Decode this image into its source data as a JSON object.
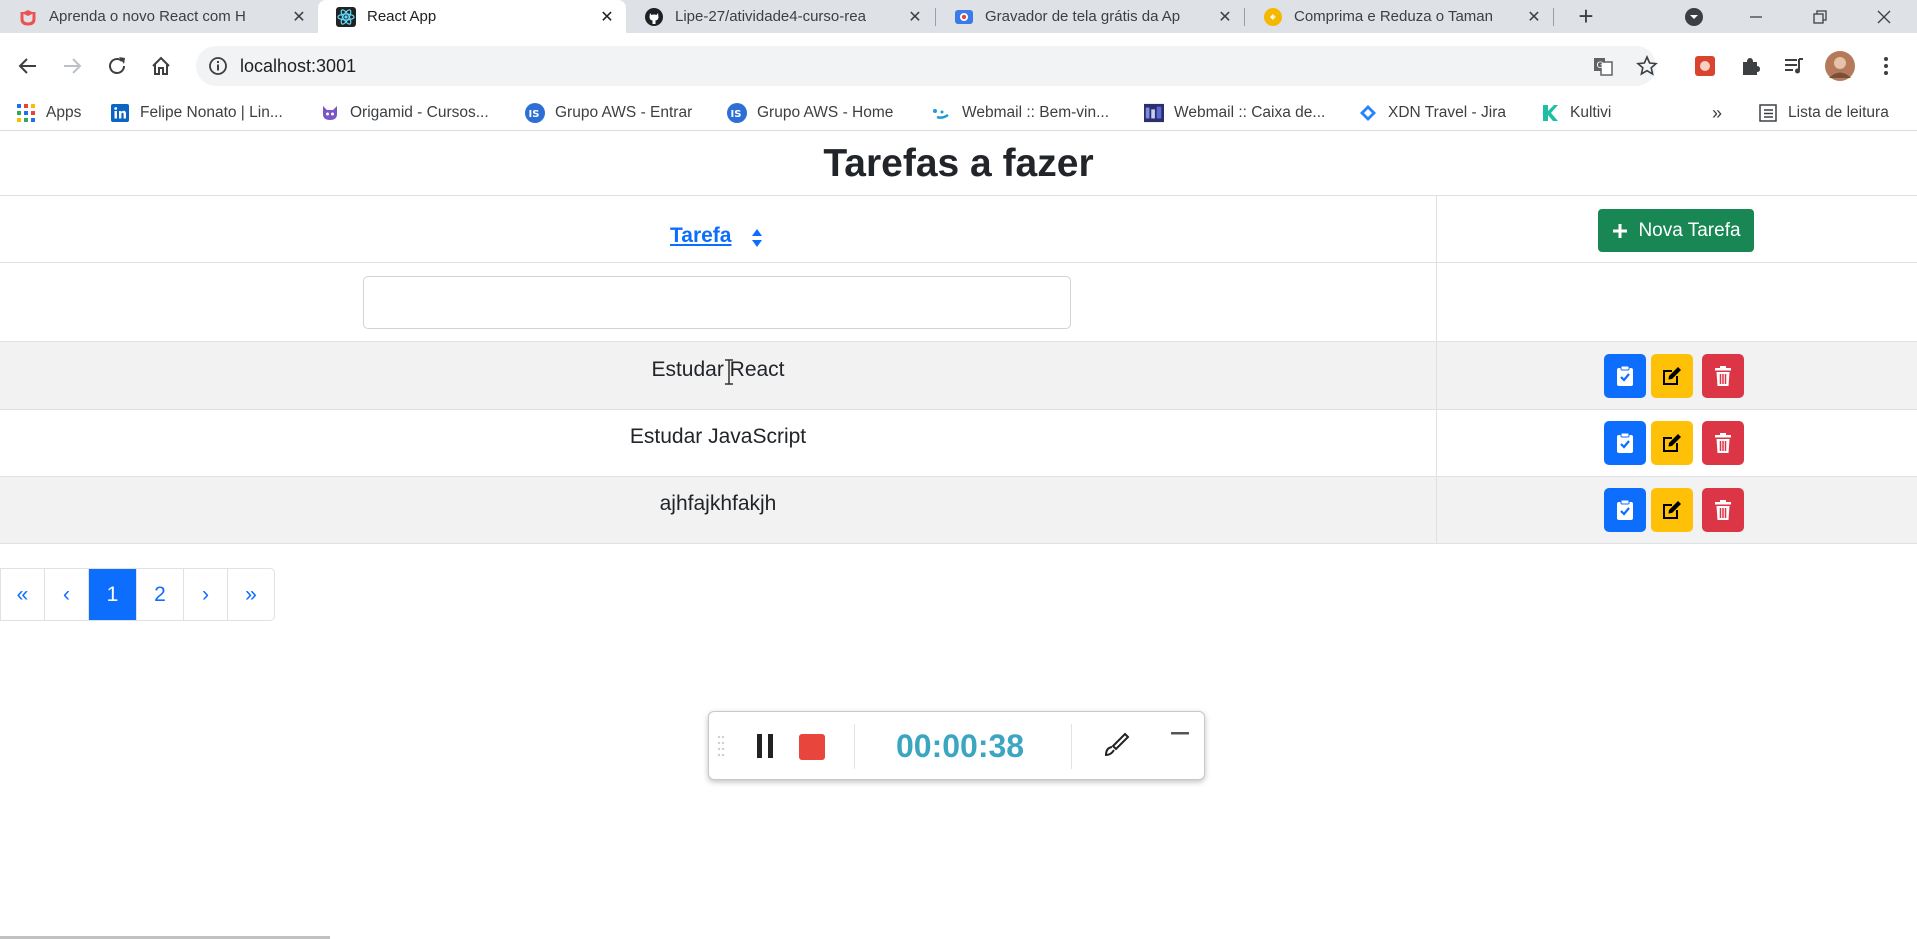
{
  "browser": {
    "tabs": [
      {
        "title": "Aprenda o novo React com H",
        "active": false,
        "icon": "udemy-icon"
      },
      {
        "title": "React App",
        "active": true,
        "icon": "react-icon"
      },
      {
        "title": "Lipe-27/atividade4-curso-rea",
        "active": false,
        "icon": "github-icon"
      },
      {
        "title": "Gravador de tela grátis da Ap",
        "active": false,
        "icon": "screen-recorder-icon"
      },
      {
        "title": "Comprima e Reduza o Taman",
        "active": false,
        "icon": "compress-icon"
      }
    ],
    "close_glyph": "✕",
    "new_tab_glyph": "+",
    "address": "localhost:3001",
    "bookmarks": [
      {
        "label": "Apps",
        "icon": "apps-grid-icon"
      },
      {
        "label": "Felipe Nonato | Lin...",
        "icon": "linkedin-icon"
      },
      {
        "label": "Origamid - Cursos...",
        "icon": "origamid-icon"
      },
      {
        "label": "Grupo AWS - Entrar",
        "icon": "grupo-aws-icon"
      },
      {
        "label": "Grupo AWS - Home",
        "icon": "grupo-aws-icon"
      },
      {
        "label": "Webmail :: Bem-vin...",
        "icon": "webmail-icon"
      },
      {
        "label": "Webmail :: Caixa de...",
        "icon": "webmail-icon"
      },
      {
        "label": "XDN Travel - Jira",
        "icon": "jira-icon"
      },
      {
        "label": "Kultivi",
        "icon": "kultivi-icon"
      }
    ],
    "bookmarks_overflow": "»",
    "reading_list": "Lista de leitura"
  },
  "page": {
    "title": "Tarefas a fazer",
    "column_header": "Tarefa",
    "new_task_button": "Nova Tarefa",
    "filter_value": "",
    "tasks": [
      {
        "name": "Estudar React"
      },
      {
        "name": "Estudar JavaScript"
      },
      {
        "name": "ajhfajkhfakjh"
      }
    ],
    "pagination": [
      "«",
      "‹",
      "1",
      "2",
      "›",
      "»"
    ],
    "current_page": "1"
  },
  "recorder": {
    "timer": "00:00:38"
  },
  "colors": {
    "primary": "#0d6efd",
    "success": "#198754",
    "warning": "#ffc107",
    "danger": "#dc3545",
    "timer": "#3ca6c2"
  }
}
